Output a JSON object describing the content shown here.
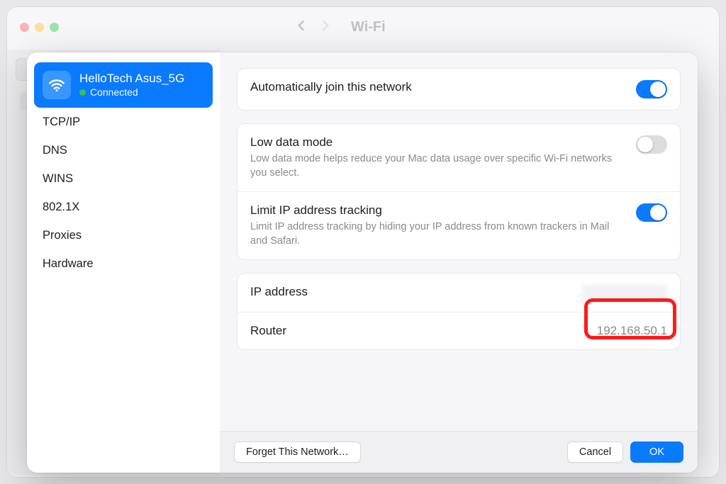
{
  "toolbar": {
    "title": "Wi-Fi"
  },
  "network": {
    "name": "HelloTech Asus_5G",
    "status": "Connected"
  },
  "sidebar": {
    "items": [
      {
        "label": "TCP/IP"
      },
      {
        "label": "DNS"
      },
      {
        "label": "WINS"
      },
      {
        "label": "802.1X"
      },
      {
        "label": "Proxies"
      },
      {
        "label": "Hardware"
      }
    ]
  },
  "settings": {
    "auto_join": {
      "label": "Automatically join this network",
      "on": true
    },
    "low_data": {
      "label": "Low data mode",
      "desc": "Low data mode helps reduce your Mac data usage over specific Wi-Fi networks you select.",
      "on": false
    },
    "limit_tracking": {
      "label": "Limit IP address tracking",
      "desc": "Limit IP address tracking by hiding your IP address from known trackers in Mail and Safari.",
      "on": true
    },
    "ip_address": {
      "label": "IP address",
      "value": ""
    },
    "router": {
      "label": "Router",
      "value": "192.168.50.1"
    }
  },
  "footer": {
    "forget": "Forget This Network…",
    "cancel": "Cancel",
    "ok": "OK"
  }
}
